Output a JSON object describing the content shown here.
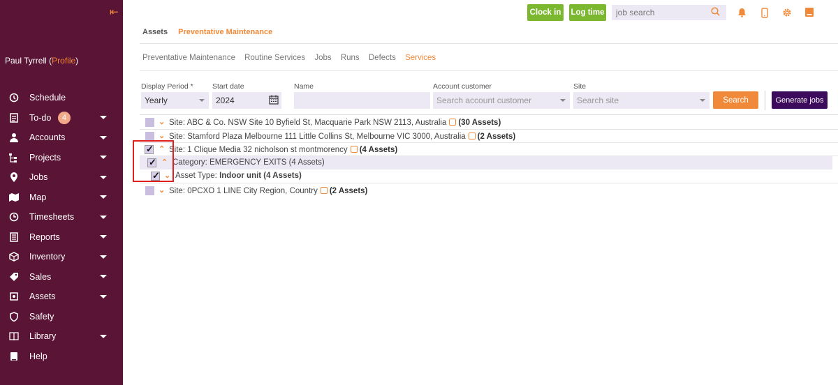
{
  "sidebar": {
    "collapse_icon": "collapse-left-icon",
    "user_name": "Paul Tyrrell (",
    "profile_link": "Profile",
    "user_suffix": ")",
    "items": [
      {
        "label": "Schedule",
        "icon": "schedule-icon"
      },
      {
        "label": "To-do",
        "icon": "todo-icon",
        "badge": "4"
      },
      {
        "label": "Accounts",
        "icon": "person-icon"
      },
      {
        "label": "Projects",
        "icon": "projects-icon"
      },
      {
        "label": "Jobs",
        "icon": "pin-icon"
      },
      {
        "label": "Map",
        "icon": "map-icon"
      },
      {
        "label": "Timesheets",
        "icon": "clock-icon"
      },
      {
        "label": "Reports",
        "icon": "reports-icon"
      },
      {
        "label": "Inventory",
        "icon": "box-icon"
      },
      {
        "label": "Sales",
        "icon": "tag-icon"
      },
      {
        "label": "Assets",
        "icon": "assets-icon"
      },
      {
        "label": "Safety",
        "icon": "shield-icon"
      },
      {
        "label": "Library",
        "icon": "book-icon"
      },
      {
        "label": "Help",
        "icon": "help-icon"
      }
    ]
  },
  "topbar": {
    "clock_in": "Clock in",
    "log_time": "Log time",
    "job_search_placeholder": "job search"
  },
  "main_tabs": {
    "assets": "Assets",
    "pm": "Preventative Maintenance"
  },
  "sub_tabs": [
    "Preventative Maintenance",
    "Routine Services",
    "Jobs",
    "Runs",
    "Defects",
    "Services"
  ],
  "filters": {
    "display_period_label": "Display Period *",
    "display_period_value": "Yearly",
    "start_date_label": "Start date",
    "start_date_value": "2024",
    "name_label": "Name",
    "account_label": "Account customer",
    "account_placeholder": "Search account customer",
    "site_label": "Site",
    "site_placeholder": "Search site",
    "search_button": "Search",
    "generate_button": "Generate jobs"
  },
  "tree": {
    "row1": {
      "text": "Site: ABC & Co. NSW Site 10 Byfield St, Macquarie Park NSW 2113, Australia",
      "count": "(30 Assets)"
    },
    "row2": {
      "text": "Site: Stamford Plaza Melbourne 111 Little Collins St, Melbourne VIC 3000, Australia",
      "count": "(2 Assets)"
    },
    "row3": {
      "text": "Site: 1 Clique Media 32 nicholson st montmorency",
      "count": "(4 Assets)"
    },
    "row4": {
      "text": "Category: EMERGENCY EXITS (4 Assets)"
    },
    "row5": {
      "prefix": "Asset Type: ",
      "bold": "Indoor unit (4 Assets)"
    },
    "row6": {
      "text": "Site: 0PCXO 1 LINE City Region, Country",
      "count": "(2 Assets)"
    }
  },
  "colors": {
    "sidebar": "#5a1435",
    "accent": "#f08a3a",
    "green": "#7cb82f",
    "generate": "#3d0b5c"
  }
}
